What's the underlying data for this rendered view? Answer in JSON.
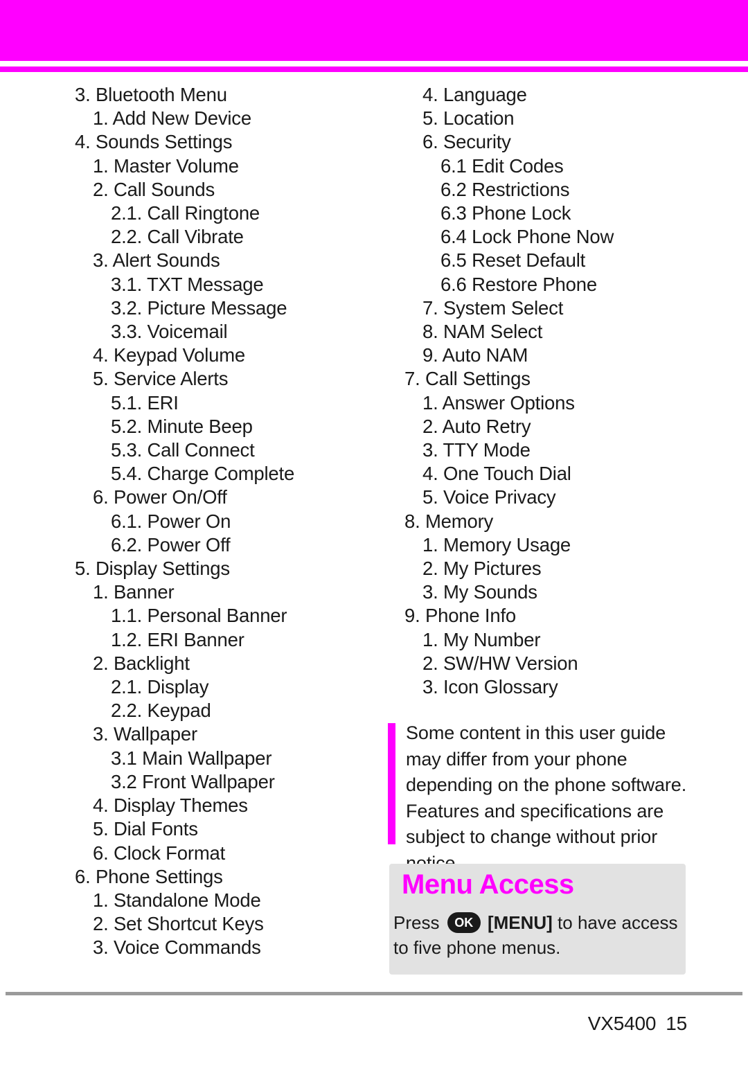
{
  "page": {
    "footer_label": "VX5400",
    "page_number": "15"
  },
  "toc_left": [
    {
      "text": "3. Bluetooth Menu",
      "level": 1
    },
    {
      "text": "1. Add New Device",
      "level": 2
    },
    {
      "text": "4. Sounds Settings",
      "level": 1
    },
    {
      "text": "1. Master Volume",
      "level": 2
    },
    {
      "text": "2. Call Sounds",
      "level": 2
    },
    {
      "text": "2.1. Call Ringtone",
      "level": 3
    },
    {
      "text": "2.2. Call Vibrate",
      "level": 3
    },
    {
      "text": "3. Alert Sounds",
      "level": 2
    },
    {
      "text": "3.1. TXT Message",
      "level": 3
    },
    {
      "text": "3.2. Picture Message",
      "level": 3
    },
    {
      "text": "3.3. Voicemail",
      "level": 3
    },
    {
      "text": "4. Keypad Volume",
      "level": 2
    },
    {
      "text": "5. Service Alerts",
      "level": 2
    },
    {
      "text": "5.1. ERI",
      "level": 3
    },
    {
      "text": "5.2. Minute Beep",
      "level": 3
    },
    {
      "text": "5.3. Call Connect",
      "level": 3
    },
    {
      "text": "5.4. Charge Complete",
      "level": 3
    },
    {
      "text": "6.  Power On/Off",
      "level": 2
    },
    {
      "text": "6.1. Power On",
      "level": 3
    },
    {
      "text": "6.2. Power Off",
      "level": 3
    },
    {
      "text": "5. Display Settings",
      "level": 1
    },
    {
      "text": "1. Banner",
      "level": 2
    },
    {
      "text": "1.1. Personal Banner",
      "level": 3
    },
    {
      "text": "1.2. ERI Banner",
      "level": 3
    },
    {
      "text": "2. Backlight",
      "level": 2
    },
    {
      "text": "2.1. Display",
      "level": 3
    },
    {
      "text": "2.2. Keypad",
      "level": 3
    },
    {
      "text": "3. Wallpaper",
      "level": 2
    },
    {
      "text": "3.1 Main Wallpaper",
      "level": 3
    },
    {
      "text": "3.2 Front Wallpaper",
      "level": 3
    },
    {
      "text": "4. Display Themes",
      "level": 2
    },
    {
      "text": "5. Dial Fonts",
      "level": 2
    },
    {
      "text": "6. Clock Format",
      "level": 2
    },
    {
      "text": "6. Phone Settings",
      "level": 1
    },
    {
      "text": "1. Standalone Mode",
      "level": 2
    },
    {
      "text": "2. Set Shortcut Keys",
      "level": 2
    },
    {
      "text": "3. Voice Commands",
      "level": 2
    }
  ],
  "toc_right": [
    {
      "text": "4. Language",
      "level": 2
    },
    {
      "text": "5. Location",
      "level": 2
    },
    {
      "text": "6. Security",
      "level": 2
    },
    {
      "text": "6.1 Edit Codes",
      "level": 3
    },
    {
      "text": "6.2 Restrictions",
      "level": 3
    },
    {
      "text": "6.3 Phone Lock",
      "level": 3
    },
    {
      "text": "6.4 Lock Phone Now",
      "level": 3
    },
    {
      "text": "6.5 Reset Default",
      "level": 3
    },
    {
      "text": "6.6 Restore Phone",
      "level": 3
    },
    {
      "text": "7. System Select",
      "level": 2
    },
    {
      "text": "8. NAM Select",
      "level": 2
    },
    {
      "text": "9. Auto NAM",
      "level": 2
    },
    {
      "text": "7. Call Settings",
      "level": 1
    },
    {
      "text": "1. Answer Options",
      "level": 2
    },
    {
      "text": "2. Auto Retry",
      "level": 2
    },
    {
      "text": "3. TTY Mode",
      "level": 2
    },
    {
      "text": "4. One Touch Dial",
      "level": 2
    },
    {
      "text": "5. Voice Privacy",
      "level": 2
    },
    {
      "text": "8. Memory",
      "level": 1
    },
    {
      "text": "1. Memory Usage",
      "level": 2
    },
    {
      "text": "2. My Pictures",
      "level": 2
    },
    {
      "text": "3. My Sounds",
      "level": 2
    },
    {
      "text": "9. Phone Info",
      "level": 1
    },
    {
      "text": "1. My Number",
      "level": 2
    },
    {
      "text": "2. SW/HW Version",
      "level": 2
    },
    {
      "text": "3. Icon Glossary",
      "level": 2
    }
  ],
  "note": {
    "text": "Some content in this user guide may differ from your phone depending on the phone software. Features and specifications are subject to change without prior notice."
  },
  "menu_access": {
    "title": "Menu Access",
    "press_label": "Press",
    "ok_label": "OK",
    "menu_label": "[MENU]",
    "tail_text": " to have access to five phone menus."
  },
  "colors": {
    "magenta": "#ff00ff",
    "box_gray": "#e2e2e2",
    "rule_gray": "#9a9a9a",
    "text": "#1a1a1a"
  }
}
